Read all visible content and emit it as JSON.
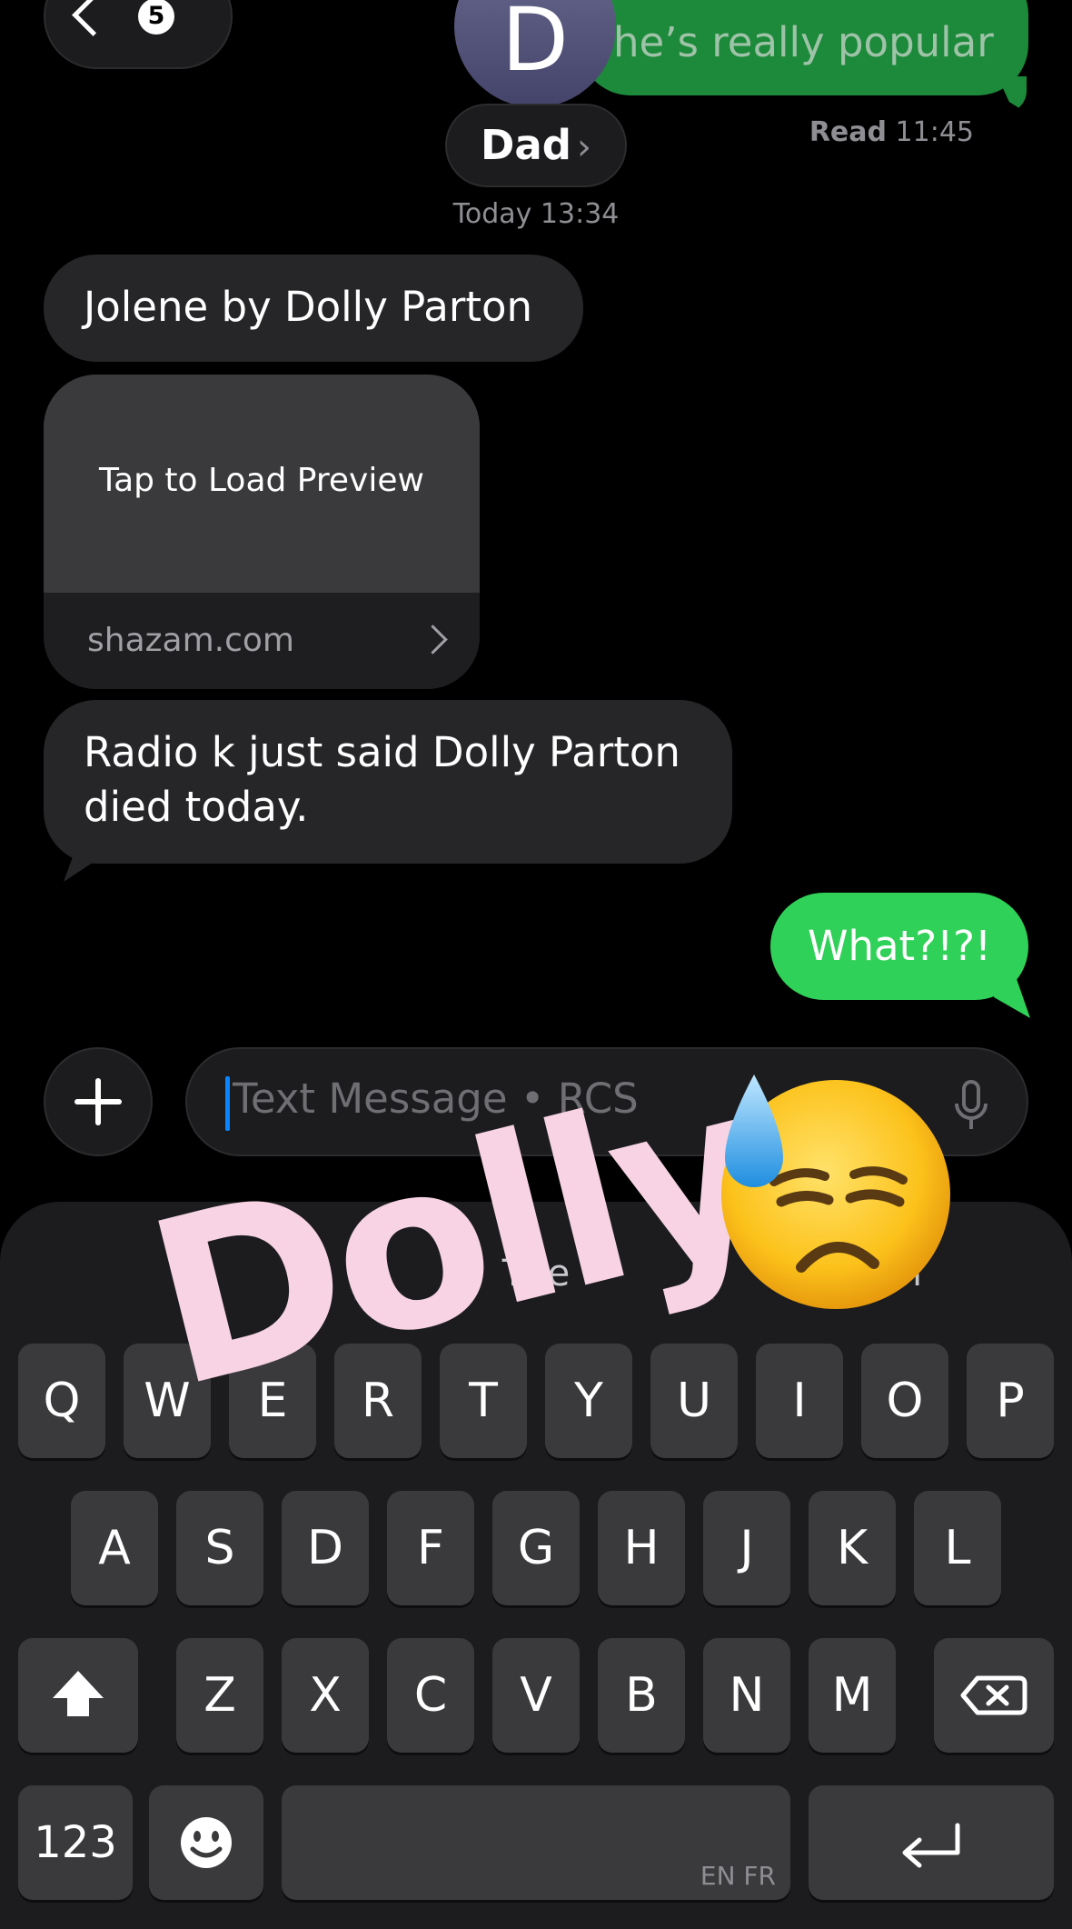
{
  "header": {
    "back_count": "5",
    "contact_initial": "D",
    "contact_name": "Dad",
    "contact_chevron": "›"
  },
  "previous_message": {
    "text": "he’s really popular",
    "status_label": "Read",
    "status_time": "11:45"
  },
  "conversation": {
    "timestamp": "Today 13:34",
    "messages": [
      {
        "direction": "incoming",
        "text": "Jolene by Dolly Parton"
      },
      {
        "direction": "incoming",
        "type": "link",
        "preview_text": "Tap to Load Preview",
        "domain": "shazam.com"
      },
      {
        "direction": "incoming",
        "text": "Radio k just said Dolly Parton died today."
      },
      {
        "direction": "outgoing",
        "text": "What?!?!"
      }
    ]
  },
  "compose": {
    "placeholder": "Text Message • RCS",
    "plus_icon": "plus-icon",
    "mic_icon": "microphone-icon"
  },
  "keyboard": {
    "suggestions": [
      "I",
      "The",
      "I'm"
    ],
    "rows": [
      [
        "Q",
        "W",
        "E",
        "R",
        "T",
        "Y",
        "U",
        "I",
        "O",
        "P"
      ],
      [
        "A",
        "S",
        "D",
        "F",
        "G",
        "H",
        "J",
        "K",
        "L"
      ],
      [
        "Z",
        "X",
        "C",
        "V",
        "B",
        "N",
        "M"
      ]
    ],
    "numbers_label": "123",
    "space_lang_label": "EN FR",
    "icons": {
      "shift": "shift-icon",
      "delete": "delete-icon",
      "emoji": "emoji-icon",
      "return": "return-icon"
    }
  },
  "overlay": {
    "sticker_text": "Dolly",
    "sticker_emoji": "downcast-face-with-sweat-emoji"
  },
  "colors": {
    "background": "#000000",
    "incoming_bubble": "#262628",
    "outgoing_bubble": "#30d158",
    "caret": "#0a84ff",
    "sticker_text": "#f7d3e3"
  }
}
